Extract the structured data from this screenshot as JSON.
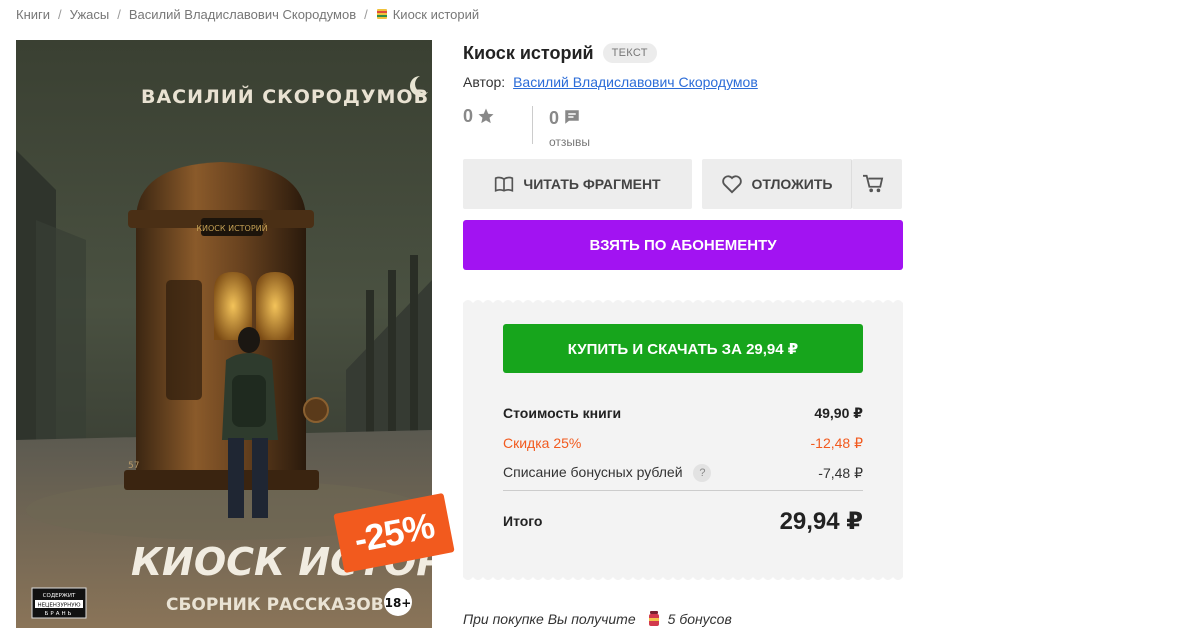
{
  "breadcrumb": {
    "items": [
      "Книги",
      "Ужасы",
      "Василий Владиславович Скородумов"
    ],
    "current": "Киоск историй",
    "separator": "/"
  },
  "cover": {
    "author_text": "ВАСИЛИЙ СКОРОДУМОВ",
    "title_text": "КИОСК ИСТОРИЙ",
    "subtitle_text": "СБОРНИК РАССКАЗОВ",
    "sign_text": "КИОСК ИСТОРИЙ",
    "booth_number": "57",
    "warning_text": [
      "СОДЕРЖИТ",
      "НЕЦЕНЗУРНУЮ",
      "БРАНЬ"
    ],
    "age_rating": "18+",
    "discount_badge": "-25%"
  },
  "book": {
    "title": "Киоск историй",
    "format": "ТЕКСТ",
    "author_label": "Автор:",
    "author_name": "Василий Владиславович Скородумов"
  },
  "ratings": {
    "rating": "0",
    "reviews_count": "0",
    "reviews_label": "отзывы"
  },
  "actions": {
    "read_fragment": "Читать фрагмент",
    "defer": "Отложить",
    "subscribe": "Взять по абонементу",
    "buy": "Купить и скачать за 29,94 ₽"
  },
  "pricing": {
    "cost_label": "Стоимость книги",
    "cost_value": "49,90 ₽",
    "discount_label": "Скидка 25%",
    "discount_value": "-12,48 ₽",
    "bonus_label": "Списание бонусных рублей",
    "bonus_help": "?",
    "bonus_value": "-7,48 ₽",
    "total_label": "Итого",
    "total_value": "29,94 ₽"
  },
  "bonus_note": {
    "prefix": "При покупке Вы получите",
    "amount": "5 бонусов"
  },
  "colors": {
    "subscribe": "#a213f2",
    "buy": "#17a51c",
    "discount": "#f25a1e",
    "link": "#2b6cd8"
  }
}
